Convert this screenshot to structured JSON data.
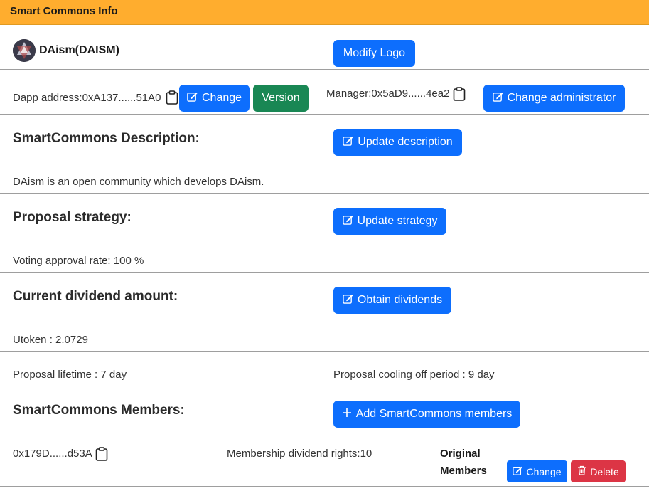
{
  "header": {
    "title": "Smart Commons Info"
  },
  "identity": {
    "name": "DAism(DAISM)",
    "logo_icon": "daism-logo",
    "modify_logo_label": "Modify Logo"
  },
  "addresses": {
    "dapp_label": "Dapp address:",
    "dapp_value": "0xA137......51A0",
    "change_label": "Change",
    "version_label": "Version",
    "manager_label": "Manager:",
    "manager_value": "0x5aD9......4ea2",
    "change_admin_label": "Change administrator"
  },
  "description": {
    "title": "SmartCommons Description:",
    "button_label": "Update description",
    "text": "DAism is an open community which develops DAism."
  },
  "strategy": {
    "title": "Proposal strategy:",
    "button_label": "Update strategy",
    "text": "Voting approval rate: 100 %"
  },
  "dividend": {
    "title": "Current dividend amount:",
    "button_label": "Obtain dividends",
    "text": "Utoken : 2.0729"
  },
  "proposal": {
    "lifetime": "Proposal lifetime : 7 day",
    "cooling": "Proposal cooling off period : 9 day"
  },
  "members": {
    "title": "SmartCommons Members:",
    "add_label": "Add SmartCommons members",
    "rows": [
      {
        "address": "0x179D......d53A",
        "rights": "Membership dividend rights:10",
        "role_line1": "Original",
        "role_line2": "Members",
        "change_label": "Change",
        "delete_label": "Delete"
      }
    ]
  },
  "colors": {
    "header": "#ffad2e",
    "primary": "#0d6efd",
    "success": "#198754",
    "danger": "#dc3545"
  }
}
